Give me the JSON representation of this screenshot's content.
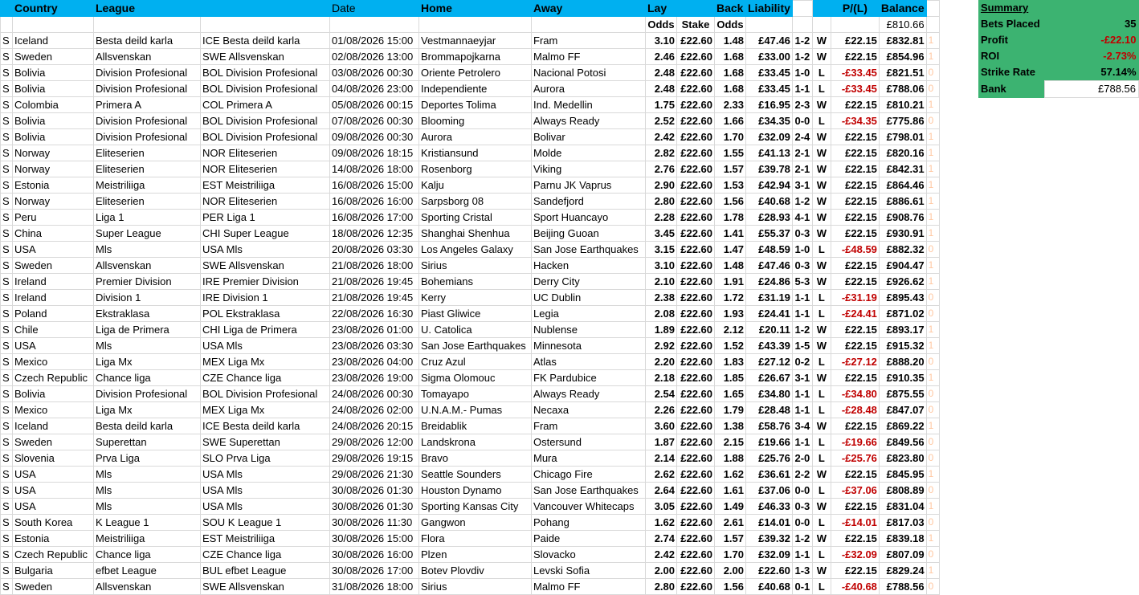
{
  "headers": {
    "flag": "",
    "country": "Country",
    "league": "League",
    "league_code": "",
    "date": "Date",
    "home": "Home",
    "away": "Away",
    "lay": "Lay",
    "stake": "",
    "back": "Back",
    "liability": "Liability",
    "score": "",
    "result": "",
    "pl": "P/(L)",
    "balance": "Balance",
    "marker": ""
  },
  "subheaders": {
    "lay_odds": "Odds",
    "stake": "Stake",
    "back_odds": "Odds",
    "opening_balance": "£810.66"
  },
  "summary": {
    "title": "Summary",
    "rows": [
      {
        "label": "Bets Placed",
        "value": "35"
      },
      {
        "label": "Profit",
        "value": "-£22.10"
      },
      {
        "label": "ROI",
        "value": "-2.73%"
      },
      {
        "label": "Strike Rate",
        "value": "57.14%"
      },
      {
        "label": "Bank",
        "value": "£788.56"
      }
    ],
    "colors": {
      "green": "#3cb371",
      "negative": "#c00000"
    }
  },
  "colors": {
    "header": "#00b0f0",
    "negative": "#c00000",
    "marker": "#ffc7a0"
  },
  "rows": [
    {
      "flag": "S",
      "country": "Iceland",
      "league": "Besta deild karla",
      "code": "ICE Besta deild karla",
      "date": "01/08/2026 15:00",
      "home": "Vestmannaeyjar",
      "away": "Fram",
      "lay": "3.10",
      "stake": "£22.60",
      "back": "1.48",
      "liability": "£47.46",
      "score": "1-2",
      "result": "W",
      "pl": "£22.15",
      "balance": "£832.81",
      "marker": "1"
    },
    {
      "flag": "S",
      "country": "Sweden",
      "league": "Allsvenskan",
      "code": "SWE Allsvenskan",
      "date": "02/08/2026 13:00",
      "home": "Brommapojkarna",
      "away": "Malmo FF",
      "lay": "2.46",
      "stake": "£22.60",
      "back": "1.68",
      "liability": "£33.00",
      "score": "1-2",
      "result": "W",
      "pl": "£22.15",
      "balance": "£854.96",
      "marker": "1"
    },
    {
      "flag": "S",
      "country": "Bolivia",
      "league": "Division Profesional",
      "code": "BOL Division Profesional",
      "date": "03/08/2026 00:30",
      "home": "Oriente Petrolero",
      "away": "Nacional Potosi",
      "lay": "2.48",
      "stake": "£22.60",
      "back": "1.68",
      "liability": "£33.45",
      "score": "1-0",
      "result": "L",
      "pl": "-£33.45",
      "balance": "£821.51",
      "marker": "0"
    },
    {
      "flag": "S",
      "country": "Bolivia",
      "league": "Division Profesional",
      "code": "BOL Division Profesional",
      "date": "04/08/2026 23:00",
      "home": "Independiente",
      "away": "Aurora",
      "lay": "2.48",
      "stake": "£22.60",
      "back": "1.68",
      "liability": "£33.45",
      "score": "1-1",
      "result": "L",
      "pl": "-£33.45",
      "balance": "£788.06",
      "marker": "0"
    },
    {
      "flag": "S",
      "country": "Colombia",
      "league": "Primera A",
      "code": "COL Primera A",
      "date": "05/08/2026 00:15",
      "home": "Deportes Tolima",
      "away": "Ind. Medellin",
      "lay": "1.75",
      "stake": "£22.60",
      "back": "2.33",
      "liability": "£16.95",
      "score": "2-3",
      "result": "W",
      "pl": "£22.15",
      "balance": "£810.21",
      "marker": "1"
    },
    {
      "flag": "S",
      "country": "Bolivia",
      "league": "Division Profesional",
      "code": "BOL Division Profesional",
      "date": "07/08/2026 00:30",
      "home": "Blooming",
      "away": "Always Ready",
      "lay": "2.52",
      "stake": "£22.60",
      "back": "1.66",
      "liability": "£34.35",
      "score": "0-0",
      "result": "L",
      "pl": "-£34.35",
      "balance": "£775.86",
      "marker": "0"
    },
    {
      "flag": "S",
      "country": "Bolivia",
      "league": "Division Profesional",
      "code": "BOL Division Profesional",
      "date": "09/08/2026 00:30",
      "home": "Aurora",
      "away": "Bolivar",
      "lay": "2.42",
      "stake": "£22.60",
      "back": "1.70",
      "liability": "£32.09",
      "score": "2-4",
      "result": "W",
      "pl": "£22.15",
      "balance": "£798.01",
      "marker": "1"
    },
    {
      "flag": "S",
      "country": "Norway",
      "league": "Eliteserien",
      "code": "NOR Eliteserien",
      "date": "09/08/2026 18:15",
      "home": "Kristiansund",
      "away": "Molde",
      "lay": "2.82",
      "stake": "£22.60",
      "back": "1.55",
      "liability": "£41.13",
      "score": "2-1",
      "result": "W",
      "pl": "£22.15",
      "balance": "£820.16",
      "marker": "1"
    },
    {
      "flag": "S",
      "country": "Norway",
      "league": "Eliteserien",
      "code": "NOR Eliteserien",
      "date": "14/08/2026 18:00",
      "home": "Rosenborg",
      "away": "Viking",
      "lay": "2.76",
      "stake": "£22.60",
      "back": "1.57",
      "liability": "£39.78",
      "score": "2-1",
      "result": "W",
      "pl": "£22.15",
      "balance": "£842.31",
      "marker": "1"
    },
    {
      "flag": "S",
      "country": "Estonia",
      "league": "Meistriliiga",
      "code": "EST Meistriliiga",
      "date": "16/08/2026 15:00",
      "home": "Kalju",
      "away": "Parnu JK Vaprus",
      "lay": "2.90",
      "stake": "£22.60",
      "back": "1.53",
      "liability": "£42.94",
      "score": "3-1",
      "result": "W",
      "pl": "£22.15",
      "balance": "£864.46",
      "marker": "1"
    },
    {
      "flag": "S",
      "country": "Norway",
      "league": "Eliteserien",
      "code": "NOR Eliteserien",
      "date": "16/08/2026 16:00",
      "home": "Sarpsborg 08",
      "away": "Sandefjord",
      "lay": "2.80",
      "stake": "£22.60",
      "back": "1.56",
      "liability": "£40.68",
      "score": "1-2",
      "result": "W",
      "pl": "£22.15",
      "balance": "£886.61",
      "marker": "1"
    },
    {
      "flag": "S",
      "country": "Peru",
      "league": "Liga 1",
      "code": "PER Liga 1",
      "date": "16/08/2026 17:00",
      "home": "Sporting Cristal",
      "away": "Sport Huancayo",
      "lay": "2.28",
      "stake": "£22.60",
      "back": "1.78",
      "liability": "£28.93",
      "score": "4-1",
      "result": "W",
      "pl": "£22.15",
      "balance": "£908.76",
      "marker": "1"
    },
    {
      "flag": "S",
      "country": "China",
      "league": "Super League",
      "code": "CHI Super League",
      "date": "18/08/2026 12:35",
      "home": "Shanghai Shenhua",
      "away": "Beijing Guoan",
      "lay": "3.45",
      "stake": "£22.60",
      "back": "1.41",
      "liability": "£55.37",
      "score": "0-3",
      "result": "W",
      "pl": "£22.15",
      "balance": "£930.91",
      "marker": "1"
    },
    {
      "flag": "S",
      "country": "USA",
      "league": "Mls",
      "code": "USA Mls",
      "date": "20/08/2026 03:30",
      "home": "Los Angeles Galaxy",
      "away": "San Jose Earthquakes",
      "lay": "3.15",
      "stake": "£22.60",
      "back": "1.47",
      "liability": "£48.59",
      "score": "1-0",
      "result": "L",
      "pl": "-£48.59",
      "balance": "£882.32",
      "marker": "0"
    },
    {
      "flag": "S",
      "country": "Sweden",
      "league": "Allsvenskan",
      "code": "SWE Allsvenskan",
      "date": "21/08/2026 18:00",
      "home": "Sirius",
      "away": "Hacken",
      "lay": "3.10",
      "stake": "£22.60",
      "back": "1.48",
      "liability": "£47.46",
      "score": "0-3",
      "result": "W",
      "pl": "£22.15",
      "balance": "£904.47",
      "marker": "1"
    },
    {
      "flag": "S",
      "country": "Ireland",
      "league": "Premier Division",
      "code": "IRE Premier Division",
      "date": "21/08/2026 19:45",
      "home": "Bohemians",
      "away": "Derry City",
      "lay": "2.10",
      "stake": "£22.60",
      "back": "1.91",
      "liability": "£24.86",
      "score": "5-3",
      "result": "W",
      "pl": "£22.15",
      "balance": "£926.62",
      "marker": "1"
    },
    {
      "flag": "S",
      "country": "Ireland",
      "league": "Division 1",
      "code": "IRE Division 1",
      "date": "21/08/2026 19:45",
      "home": "Kerry",
      "away": "UC Dublin",
      "lay": "2.38",
      "stake": "£22.60",
      "back": "1.72",
      "liability": "£31.19",
      "score": "1-1",
      "result": "L",
      "pl": "-£31.19",
      "balance": "£895.43",
      "marker": "0"
    },
    {
      "flag": "S",
      "country": "Poland",
      "league": "Ekstraklasa",
      "code": "POL Ekstraklasa",
      "date": "22/08/2026 16:30",
      "home": "Piast Gliwice",
      "away": "Legia",
      "lay": "2.08",
      "stake": "£22.60",
      "back": "1.93",
      "liability": "£24.41",
      "score": "1-1",
      "result": "L",
      "pl": "-£24.41",
      "balance": "£871.02",
      "marker": "0"
    },
    {
      "flag": "S",
      "country": "Chile",
      "league": "Liga de Primera",
      "code": "CHI Liga de Primera",
      "date": "23/08/2026 01:00",
      "home": "U. Catolica",
      "away": "Nublense",
      "lay": "1.89",
      "stake": "£22.60",
      "back": "2.12",
      "liability": "£20.11",
      "score": "1-2",
      "result": "W",
      "pl": "£22.15",
      "balance": "£893.17",
      "marker": "1"
    },
    {
      "flag": "S",
      "country": "USA",
      "league": "Mls",
      "code": "USA Mls",
      "date": "23/08/2026 03:30",
      "home": "San Jose Earthquakes",
      "away": "Minnesota",
      "lay": "2.92",
      "stake": "£22.60",
      "back": "1.52",
      "liability": "£43.39",
      "score": "1-5",
      "result": "W",
      "pl": "£22.15",
      "balance": "£915.32",
      "marker": "1"
    },
    {
      "flag": "S",
      "country": "Mexico",
      "league": "Liga Mx",
      "code": "MEX Liga Mx",
      "date": "23/08/2026 04:00",
      "home": "Cruz Azul",
      "away": "Atlas",
      "lay": "2.20",
      "stake": "£22.60",
      "back": "1.83",
      "liability": "£27.12",
      "score": "0-2",
      "result": "L",
      "pl": "-£27.12",
      "balance": "£888.20",
      "marker": "0"
    },
    {
      "flag": "S",
      "country": "Czech Republic",
      "league": "Chance liga",
      "code": "CZE Chance liga",
      "date": "23/08/2026 19:00",
      "home": "Sigma Olomouc",
      "away": "FK Pardubice",
      "lay": "2.18",
      "stake": "£22.60",
      "back": "1.85",
      "liability": "£26.67",
      "score": "3-1",
      "result": "W",
      "pl": "£22.15",
      "balance": "£910.35",
      "marker": "1"
    },
    {
      "flag": "S",
      "country": "Bolivia",
      "league": "Division Profesional",
      "code": "BOL Division Profesional",
      "date": "24/08/2026 00:30",
      "home": "Tomayapo",
      "away": "Always Ready",
      "lay": "2.54",
      "stake": "£22.60",
      "back": "1.65",
      "liability": "£34.80",
      "score": "1-1",
      "result": "L",
      "pl": "-£34.80",
      "balance": "£875.55",
      "marker": "0"
    },
    {
      "flag": "S",
      "country": "Mexico",
      "league": "Liga Mx",
      "code": "MEX Liga Mx",
      "date": "24/08/2026 02:00",
      "home": "U.N.A.M.- Pumas",
      "away": "Necaxa",
      "lay": "2.26",
      "stake": "£22.60",
      "back": "1.79",
      "liability": "£28.48",
      "score": "1-1",
      "result": "L",
      "pl": "-£28.48",
      "balance": "£847.07",
      "marker": "0"
    },
    {
      "flag": "S",
      "country": "Iceland",
      "league": "Besta deild karla",
      "code": "ICE Besta deild karla",
      "date": "24/08/2026 20:15",
      "home": "Breidablik",
      "away": "Fram",
      "lay": "3.60",
      "stake": "£22.60",
      "back": "1.38",
      "liability": "£58.76",
      "score": "3-4",
      "result": "W",
      "pl": "£22.15",
      "balance": "£869.22",
      "marker": "1"
    },
    {
      "flag": "S",
      "country": "Sweden",
      "league": "Superettan",
      "code": "SWE Superettan",
      "date": "29/08/2026 12:00",
      "home": "Landskrona",
      "away": "Ostersund",
      "lay": "1.87",
      "stake": "£22.60",
      "back": "2.15",
      "liability": "£19.66",
      "score": "1-1",
      "result": "L",
      "pl": "-£19.66",
      "balance": "£849.56",
      "marker": "0"
    },
    {
      "flag": "S",
      "country": "Slovenia",
      "league": "Prva Liga",
      "code": "SLO Prva Liga",
      "date": "29/08/2026 19:15",
      "home": "Bravo",
      "away": "Mura",
      "lay": "2.14",
      "stake": "£22.60",
      "back": "1.88",
      "liability": "£25.76",
      "score": "2-0",
      "result": "L",
      "pl": "-£25.76",
      "balance": "£823.80",
      "marker": "0"
    },
    {
      "flag": "S",
      "country": "USA",
      "league": "Mls",
      "code": "USA Mls",
      "date": "29/08/2026 21:30",
      "home": "Seattle Sounders",
      "away": "Chicago Fire",
      "lay": "2.62",
      "stake": "£22.60",
      "back": "1.62",
      "liability": "£36.61",
      "score": "2-2",
      "result": "W",
      "pl": "£22.15",
      "balance": "£845.95",
      "marker": "1"
    },
    {
      "flag": "S",
      "country": "USA",
      "league": "Mls",
      "code": "USA Mls",
      "date": "30/08/2026 01:30",
      "home": "Houston Dynamo",
      "away": "San Jose Earthquakes",
      "lay": "2.64",
      "stake": "£22.60",
      "back": "1.61",
      "liability": "£37.06",
      "score": "0-0",
      "result": "L",
      "pl": "-£37.06",
      "balance": "£808.89",
      "marker": "0"
    },
    {
      "flag": "S",
      "country": "USA",
      "league": "Mls",
      "code": "USA Mls",
      "date": "30/08/2026 01:30",
      "home": "Sporting Kansas City",
      "away": "Vancouver Whitecaps",
      "lay": "3.05",
      "stake": "£22.60",
      "back": "1.49",
      "liability": "£46.33",
      "score": "0-3",
      "result": "W",
      "pl": "£22.15",
      "balance": "£831.04",
      "marker": "1"
    },
    {
      "flag": "S",
      "country": "South Korea",
      "league": "K League 1",
      "code": "SOU K League 1",
      "date": "30/08/2026 11:30",
      "home": "Gangwon",
      "away": "Pohang",
      "lay": "1.62",
      "stake": "£22.60",
      "back": "2.61",
      "liability": "£14.01",
      "score": "0-0",
      "result": "L",
      "pl": "-£14.01",
      "balance": "£817.03",
      "marker": "0"
    },
    {
      "flag": "S",
      "country": "Estonia",
      "league": "Meistriliiga",
      "code": "EST Meistriliiga",
      "date": "30/08/2026 15:00",
      "home": "Flora",
      "away": "Paide",
      "lay": "2.74",
      "stake": "£22.60",
      "back": "1.57",
      "liability": "£39.32",
      "score": "1-2",
      "result": "W",
      "pl": "£22.15",
      "balance": "£839.18",
      "marker": "1"
    },
    {
      "flag": "S",
      "country": "Czech Republic",
      "league": "Chance liga",
      "code": "CZE Chance liga",
      "date": "30/08/2026 16:00",
      "home": "Plzen",
      "away": "Slovacko",
      "lay": "2.42",
      "stake": "£22.60",
      "back": "1.70",
      "liability": "£32.09",
      "score": "1-1",
      "result": "L",
      "pl": "-£32.09",
      "balance": "£807.09",
      "marker": "0"
    },
    {
      "flag": "S",
      "country": "Bulgaria",
      "league": "efbet League",
      "code": "BUL efbet League",
      "date": "30/08/2026 17:00",
      "home": "Botev Plovdiv",
      "away": "Levski Sofia",
      "lay": "2.00",
      "stake": "£22.60",
      "back": "2.00",
      "liability": "£22.60",
      "score": "1-3",
      "result": "W",
      "pl": "£22.15",
      "balance": "£829.24",
      "marker": "1"
    },
    {
      "flag": "S",
      "country": "Sweden",
      "league": "Allsvenskan",
      "code": "SWE Allsvenskan",
      "date": "31/08/2026 18:00",
      "home": "Sirius",
      "away": "Malmo FF",
      "lay": "2.80",
      "stake": "£22.60",
      "back": "1.56",
      "liability": "£40.68",
      "score": "0-1",
      "result": "L",
      "pl": "-£40.68",
      "balance": "£788.56",
      "marker": "0"
    }
  ]
}
